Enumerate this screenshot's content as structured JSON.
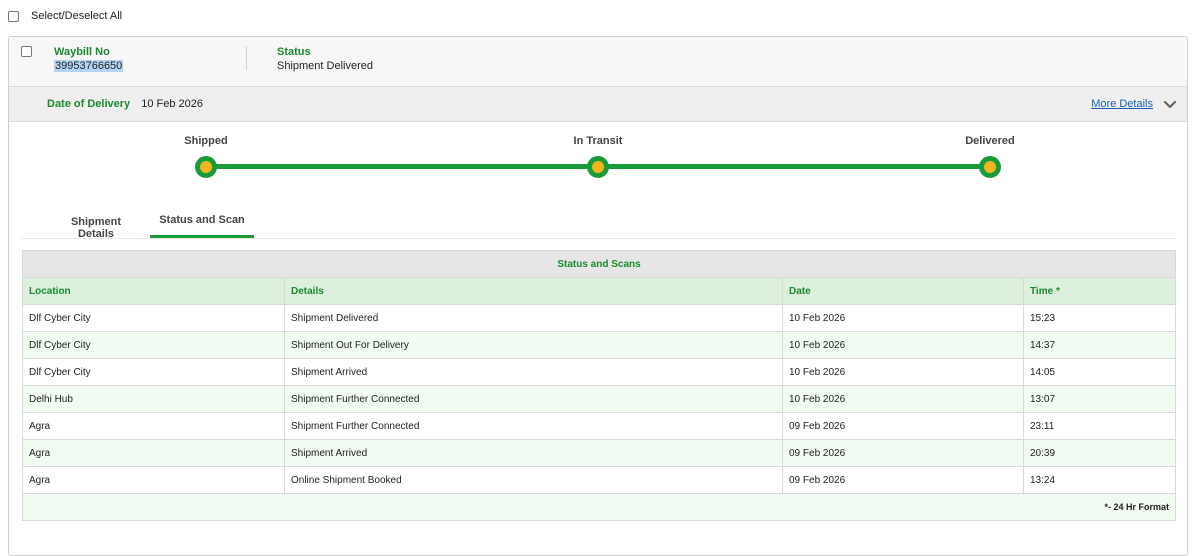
{
  "select_all": {
    "label": "Select/Deselect All"
  },
  "shipment": {
    "waybill_label": "Waybill No",
    "waybill_no": "39953766650",
    "status_label": "Status",
    "status_value": "Shipment Delivered",
    "date_of_delivery_label": "Date of Delivery",
    "date_of_delivery": "10 Feb 2026",
    "more_details": "More Details",
    "chevron_icon": "chevron-down-icon"
  },
  "progress": {
    "stages": [
      "Shipped",
      "In Transit",
      "Delivered"
    ],
    "completed_fraction": 1.0
  },
  "tabs": [
    {
      "label": "Shipment Details",
      "active": false
    },
    {
      "label": "Status and Scan",
      "active": true
    }
  ],
  "scans": {
    "caption": "Status and Scans",
    "columns": [
      "Location",
      "Details",
      "Date",
      "Time *"
    ],
    "rows": [
      [
        "Dlf Cyber City",
        "Shipment Delivered",
        "10 Feb 2026",
        "15:23"
      ],
      [
        "Dlf Cyber City",
        "Shipment Out For Delivery",
        "10 Feb 2026",
        "14:37"
      ],
      [
        "Dlf Cyber City",
        "Shipment Arrived",
        "10 Feb 2026",
        "14:05"
      ],
      [
        "Delhi Hub",
        "Shipment Further Connected",
        "10 Feb 2026",
        "13:07"
      ],
      [
        "Agra",
        "Shipment Further Connected",
        "09 Feb 2026",
        "23:11"
      ],
      [
        "Agra",
        "Shipment Arrived",
        "09 Feb 2026",
        "20:39"
      ],
      [
        "Agra",
        "Online Shipment Booked",
        "09 Feb 2026",
        "13:24"
      ]
    ],
    "footnote": "*- 24 Hr Format"
  },
  "colors": {
    "accent_green": "#1a9c3a",
    "dot_yellow": "#f2b51d",
    "link_blue": "#1a5fb4"
  }
}
